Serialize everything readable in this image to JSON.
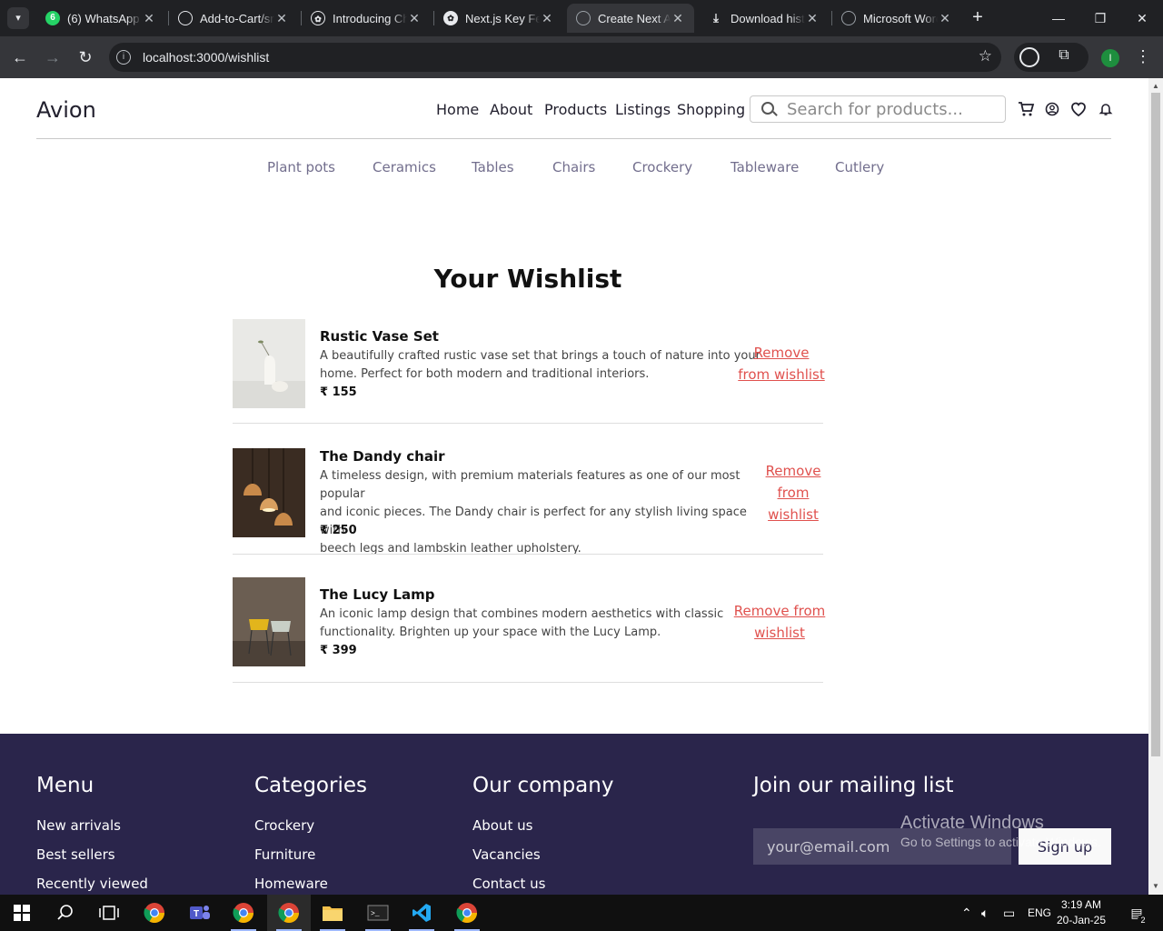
{
  "browser": {
    "tabs": [
      {
        "label": "(6) WhatsApp",
        "icon": "whatsapp-icon",
        "badge": "6",
        "active": false
      },
      {
        "label": "Add-to-Cart/src",
        "icon": "github-icon",
        "active": false
      },
      {
        "label": "Introducing ChatGPT",
        "icon": "chatgpt-icon",
        "active": false
      },
      {
        "label": "Next.js Key Features",
        "icon": "chatgpt-icon",
        "active": false
      },
      {
        "label": "Create Next App",
        "icon": "globe-icon",
        "active": true
      },
      {
        "label": "Download history",
        "icon": "download-icon",
        "active": false
      },
      {
        "label": "Microsoft Word",
        "icon": "globe-icon",
        "active": false
      }
    ],
    "url": "localhost:3000/wishlist",
    "profile_initial": "I"
  },
  "site": {
    "brand": "Avion",
    "nav": [
      "Home",
      "About",
      "Products",
      "Listings",
      "Shopping"
    ],
    "search_placeholder": "Search for products...",
    "categories": [
      "Plant pots",
      "Ceramics",
      "Tables",
      "Chairs",
      "Crockery",
      "Tableware",
      "Cutlery"
    ]
  },
  "wishlist": {
    "title": "Your Wishlist",
    "remove_label": "Remove from wishlist",
    "items": [
      {
        "name": "Rustic Vase Set",
        "desc_lines": [
          "A beautifully crafted rustic vase set that brings a touch of nature into your",
          "home. Perfect for both modern and traditional interiors."
        ],
        "price": "₹ 155",
        "remove_lines": [
          "Remove",
          "from wishlist"
        ]
      },
      {
        "name": "The Dandy chair",
        "desc_lines": [
          "A timeless design, with premium materials features as one of our most popular",
          "and iconic pieces. The Dandy chair is perfect for any stylish living space with",
          "beech legs and lambskin leather upholstery."
        ],
        "price": "₹ 250",
        "remove_lines": [
          "Remove",
          "from",
          "wishlist"
        ]
      },
      {
        "name": "The Lucy Lamp",
        "desc_lines": [
          "An iconic lamp design that combines modern aesthetics with classic",
          "functionality. Brighten up your space with the Lucy Lamp."
        ],
        "price": "₹ 399",
        "remove_lines": [
          "Remove from",
          "wishlist"
        ]
      }
    ]
  },
  "footer": {
    "menu": {
      "title": "Menu",
      "links": [
        "New arrivals",
        "Best sellers",
        "Recently viewed"
      ]
    },
    "categories": {
      "title": "Categories",
      "links": [
        "Crockery",
        "Furniture",
        "Homeware"
      ]
    },
    "company": {
      "title": "Our company",
      "links": [
        "About us",
        "Vacancies",
        "Contact us"
      ]
    },
    "mailing": {
      "title": "Join our mailing list",
      "placeholder": "your@email.com",
      "button": "Sign up"
    }
  },
  "watermark": {
    "line1": "Activate Windows",
    "line2": "Go to Settings to activate Windows."
  },
  "taskbar": {
    "lang": "ENG",
    "time": "3:19 AM",
    "date": "20-Jan-25",
    "notifications": "2"
  },
  "colors": {
    "footer_bg": "#2a254b",
    "remove_link": "#e0514e",
    "category_text": "#726e8d"
  }
}
